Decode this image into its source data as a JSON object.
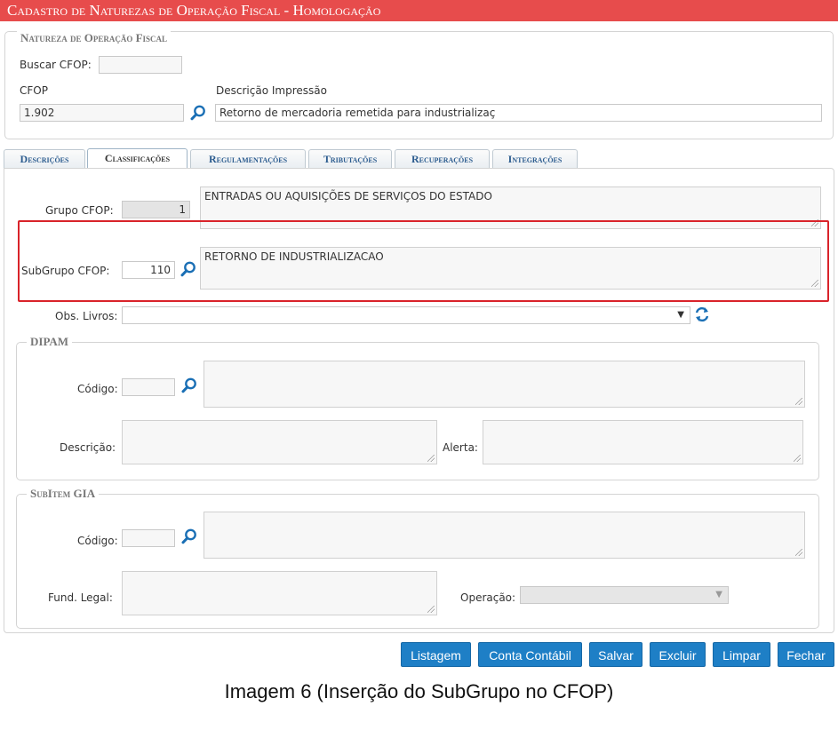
{
  "window": {
    "title": "Cadastro de Naturezas de Operação Fiscal  - Homologação"
  },
  "natureza": {
    "legend": "Natureza de Operação Fiscal",
    "buscar_cfop_label": "Buscar CFOP:",
    "buscar_cfop_value": "",
    "cfop_label": "CFOP",
    "cfop_value": "1.902",
    "descricao_label": "Descrição Impressão",
    "descricao_value": "Retorno de mercadoria remetida para industrializaç"
  },
  "tabs": [
    {
      "label": "Descrições",
      "active": false
    },
    {
      "label": "Classificações",
      "active": true
    },
    {
      "label": "Regulamentações",
      "active": false
    },
    {
      "label": "Tributações",
      "active": false
    },
    {
      "label": "Recuperações",
      "active": false
    },
    {
      "label": "Integrações",
      "active": false
    }
  ],
  "classificacoes": {
    "grupo_label": "Grupo CFOP:",
    "grupo_value": "1",
    "grupo_desc": "ENTRADAS OU AQUISIÇÕES DE SERVIÇOS DO ESTADO",
    "subgrupo_label": "SubGrupo CFOP:",
    "subgrupo_value": "110",
    "subgrupo_desc": "RETORNO DE INDUSTRIALIZACAO",
    "obs_label": "Obs. Livros:",
    "obs_value": ""
  },
  "dipam": {
    "legend": "DIPAM",
    "codigo_label": "Código:",
    "codigo_value": "",
    "descricao_label": "Descrição:",
    "alerta_label": "Alerta:"
  },
  "subitem": {
    "legend": "SubItem GIA",
    "codigo_label": "Código:",
    "codigo_value": "",
    "fund_legal_label": "Fund. Legal:",
    "operacao_label": "Operação:",
    "operacao_value": ""
  },
  "buttons": {
    "listagem": "Listagem",
    "conta_contabil": "Conta Contábil",
    "salvar": "Salvar",
    "excluir": "Excluir",
    "limpar": "Limpar",
    "fechar": "Fechar"
  },
  "caption": "Imagem 6 (Inserção do SubGrupo no CFOP)",
  "colors": {
    "titlebar": "#e74c4c",
    "highlight": "#d9232a",
    "button": "#1e7fc6"
  },
  "icons": [
    "search-icon",
    "refresh-icon",
    "dropdown-arrow-icon"
  ]
}
